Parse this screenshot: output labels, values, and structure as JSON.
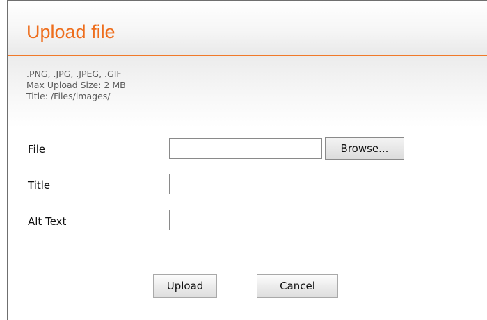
{
  "header": {
    "title": "Upload file"
  },
  "info": {
    "formats": ".PNG, .JPG, .JPEG, .GIF",
    "max_size": "Max Upload Size: 2 MB",
    "path": "Title: /Files/images/"
  },
  "form": {
    "file": {
      "label": "File",
      "value": "",
      "browse_label": "Browse..."
    },
    "title": {
      "label": "Title",
      "value": ""
    },
    "alt_text": {
      "label": "Alt Text",
      "value": ""
    }
  },
  "actions": {
    "upload_label": "Upload",
    "cancel_label": "Cancel"
  },
  "colors": {
    "accent": "#ee6e1d",
    "header_rule": "#f07a2a"
  }
}
